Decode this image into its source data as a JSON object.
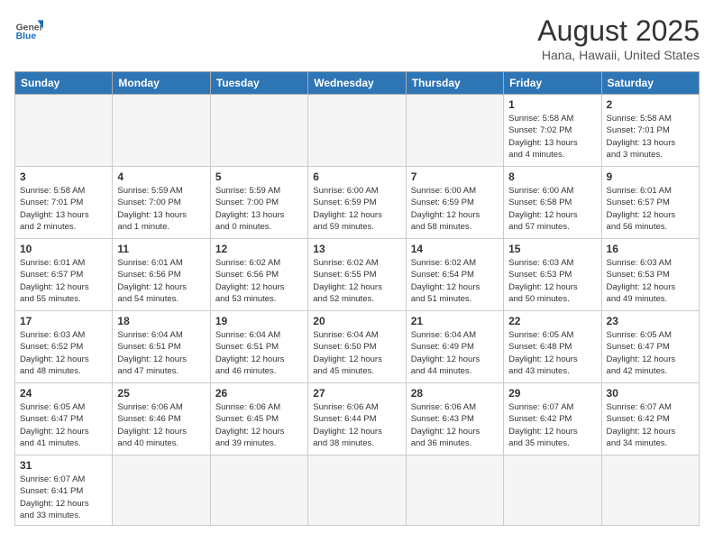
{
  "header": {
    "logo_general": "General",
    "logo_blue": "Blue",
    "month_title": "August 2025",
    "subtitle": "Hana, Hawaii, United States"
  },
  "weekdays": [
    "Sunday",
    "Monday",
    "Tuesday",
    "Wednesday",
    "Thursday",
    "Friday",
    "Saturday"
  ],
  "weeks": [
    [
      {
        "day": "",
        "info": ""
      },
      {
        "day": "",
        "info": ""
      },
      {
        "day": "",
        "info": ""
      },
      {
        "day": "",
        "info": ""
      },
      {
        "day": "",
        "info": ""
      },
      {
        "day": "1",
        "info": "Sunrise: 5:58 AM\nSunset: 7:02 PM\nDaylight: 13 hours\nand 4 minutes."
      },
      {
        "day": "2",
        "info": "Sunrise: 5:58 AM\nSunset: 7:01 PM\nDaylight: 13 hours\nand 3 minutes."
      }
    ],
    [
      {
        "day": "3",
        "info": "Sunrise: 5:58 AM\nSunset: 7:01 PM\nDaylight: 13 hours\nand 2 minutes."
      },
      {
        "day": "4",
        "info": "Sunrise: 5:59 AM\nSunset: 7:00 PM\nDaylight: 13 hours\nand 1 minute."
      },
      {
        "day": "5",
        "info": "Sunrise: 5:59 AM\nSunset: 7:00 PM\nDaylight: 13 hours\nand 0 minutes."
      },
      {
        "day": "6",
        "info": "Sunrise: 6:00 AM\nSunset: 6:59 PM\nDaylight: 12 hours\nand 59 minutes."
      },
      {
        "day": "7",
        "info": "Sunrise: 6:00 AM\nSunset: 6:59 PM\nDaylight: 12 hours\nand 58 minutes."
      },
      {
        "day": "8",
        "info": "Sunrise: 6:00 AM\nSunset: 6:58 PM\nDaylight: 12 hours\nand 57 minutes."
      },
      {
        "day": "9",
        "info": "Sunrise: 6:01 AM\nSunset: 6:57 PM\nDaylight: 12 hours\nand 56 minutes."
      }
    ],
    [
      {
        "day": "10",
        "info": "Sunrise: 6:01 AM\nSunset: 6:57 PM\nDaylight: 12 hours\nand 55 minutes."
      },
      {
        "day": "11",
        "info": "Sunrise: 6:01 AM\nSunset: 6:56 PM\nDaylight: 12 hours\nand 54 minutes."
      },
      {
        "day": "12",
        "info": "Sunrise: 6:02 AM\nSunset: 6:56 PM\nDaylight: 12 hours\nand 53 minutes."
      },
      {
        "day": "13",
        "info": "Sunrise: 6:02 AM\nSunset: 6:55 PM\nDaylight: 12 hours\nand 52 minutes."
      },
      {
        "day": "14",
        "info": "Sunrise: 6:02 AM\nSunset: 6:54 PM\nDaylight: 12 hours\nand 51 minutes."
      },
      {
        "day": "15",
        "info": "Sunrise: 6:03 AM\nSunset: 6:53 PM\nDaylight: 12 hours\nand 50 minutes."
      },
      {
        "day": "16",
        "info": "Sunrise: 6:03 AM\nSunset: 6:53 PM\nDaylight: 12 hours\nand 49 minutes."
      }
    ],
    [
      {
        "day": "17",
        "info": "Sunrise: 6:03 AM\nSunset: 6:52 PM\nDaylight: 12 hours\nand 48 minutes."
      },
      {
        "day": "18",
        "info": "Sunrise: 6:04 AM\nSunset: 6:51 PM\nDaylight: 12 hours\nand 47 minutes."
      },
      {
        "day": "19",
        "info": "Sunrise: 6:04 AM\nSunset: 6:51 PM\nDaylight: 12 hours\nand 46 minutes."
      },
      {
        "day": "20",
        "info": "Sunrise: 6:04 AM\nSunset: 6:50 PM\nDaylight: 12 hours\nand 45 minutes."
      },
      {
        "day": "21",
        "info": "Sunrise: 6:04 AM\nSunset: 6:49 PM\nDaylight: 12 hours\nand 44 minutes."
      },
      {
        "day": "22",
        "info": "Sunrise: 6:05 AM\nSunset: 6:48 PM\nDaylight: 12 hours\nand 43 minutes."
      },
      {
        "day": "23",
        "info": "Sunrise: 6:05 AM\nSunset: 6:47 PM\nDaylight: 12 hours\nand 42 minutes."
      }
    ],
    [
      {
        "day": "24",
        "info": "Sunrise: 6:05 AM\nSunset: 6:47 PM\nDaylight: 12 hours\nand 41 minutes."
      },
      {
        "day": "25",
        "info": "Sunrise: 6:06 AM\nSunset: 6:46 PM\nDaylight: 12 hours\nand 40 minutes."
      },
      {
        "day": "26",
        "info": "Sunrise: 6:06 AM\nSunset: 6:45 PM\nDaylight: 12 hours\nand 39 minutes."
      },
      {
        "day": "27",
        "info": "Sunrise: 6:06 AM\nSunset: 6:44 PM\nDaylight: 12 hours\nand 38 minutes."
      },
      {
        "day": "28",
        "info": "Sunrise: 6:06 AM\nSunset: 6:43 PM\nDaylight: 12 hours\nand 36 minutes."
      },
      {
        "day": "29",
        "info": "Sunrise: 6:07 AM\nSunset: 6:42 PM\nDaylight: 12 hours\nand 35 minutes."
      },
      {
        "day": "30",
        "info": "Sunrise: 6:07 AM\nSunset: 6:42 PM\nDaylight: 12 hours\nand 34 minutes."
      }
    ],
    [
      {
        "day": "31",
        "info": "Sunrise: 6:07 AM\nSunset: 6:41 PM\nDaylight: 12 hours\nand 33 minutes."
      },
      {
        "day": "",
        "info": ""
      },
      {
        "day": "",
        "info": ""
      },
      {
        "day": "",
        "info": ""
      },
      {
        "day": "",
        "info": ""
      },
      {
        "day": "",
        "info": ""
      },
      {
        "day": "",
        "info": ""
      }
    ]
  ]
}
